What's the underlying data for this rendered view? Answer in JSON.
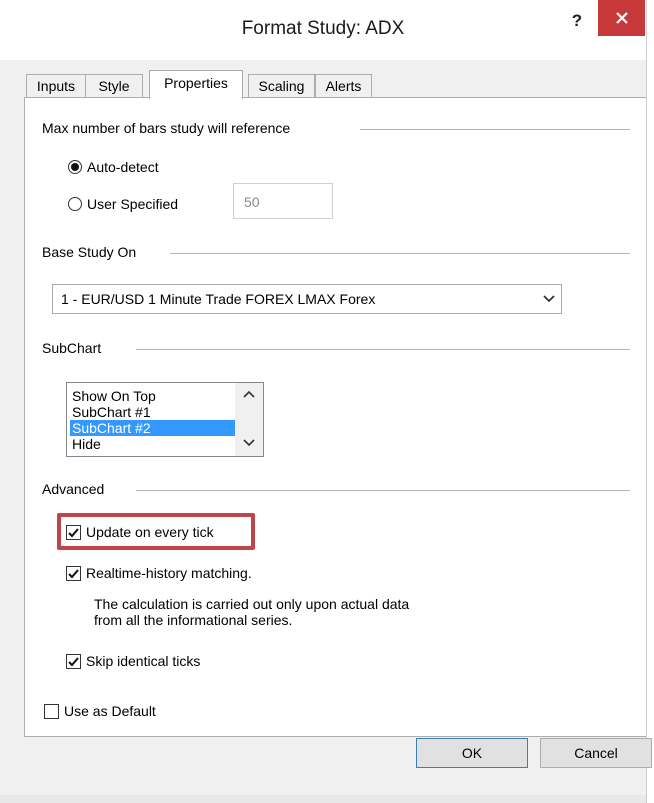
{
  "dialog": {
    "title": "Format Study: ADX",
    "help_label": "?"
  },
  "tabs": [
    {
      "label": "Inputs",
      "active": false
    },
    {
      "label": "Style",
      "active": false
    },
    {
      "label": "Properties",
      "active": true
    },
    {
      "label": "Scaling",
      "active": false
    },
    {
      "label": "Alerts",
      "active": false
    }
  ],
  "max_bars": {
    "group_label": "Max number of bars study will reference",
    "auto_detect_label": "Auto-detect",
    "auto_detect_selected": true,
    "user_specified_label": "User Specified",
    "user_specified_value": "50"
  },
  "base_study": {
    "group_label": "Base Study On",
    "selected": "1 - EUR/USD 1 Minute Trade FOREX LMAX Forex"
  },
  "subchart": {
    "group_label": "SubChart",
    "options": [
      "Show On Top",
      "SubChart #1",
      "SubChart #2",
      "Hide"
    ],
    "selected_index": 2
  },
  "advanced": {
    "group_label": "Advanced",
    "update_every_tick_label": "Update on every tick",
    "update_every_tick_checked": true,
    "realtime_history_label": "Realtime-history matching.",
    "realtime_history_checked": true,
    "note_line1": "The calculation is carried out only upon actual data",
    "note_line2": "from all the informational series.",
    "skip_identical_label": "Skip identical ticks",
    "skip_identical_checked": true
  },
  "use_as_default": {
    "label": "Use as Default",
    "checked": false
  },
  "buttons": {
    "ok": "OK",
    "cancel": "Cancel"
  },
  "colors": {
    "close_button": "#c7383a",
    "highlight_border": "#c0454a",
    "selection": "#3399ff"
  }
}
